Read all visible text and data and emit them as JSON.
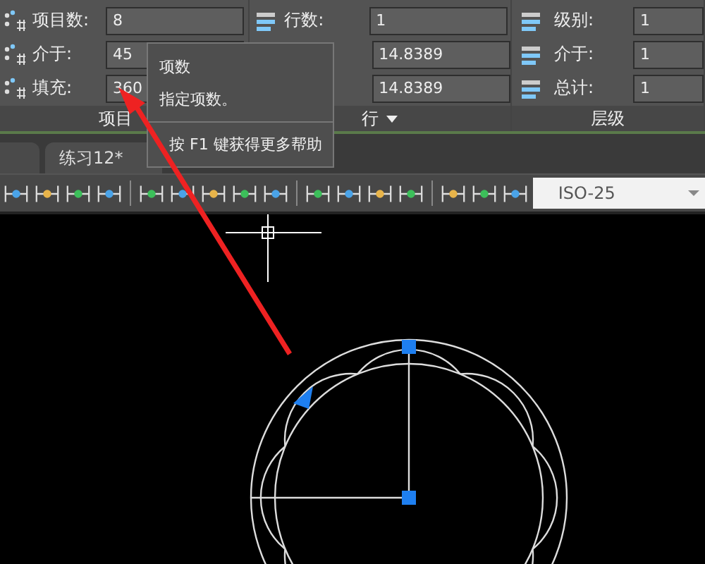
{
  "ribbon": {
    "panels": [
      {
        "label": "项目",
        "dropdown": false,
        "fields": [
          {
            "label": "项目数:",
            "value": "8"
          },
          {
            "label": "介于:",
            "value": "45"
          },
          {
            "label": "填充:",
            "value": "360"
          }
        ]
      },
      {
        "label": "行",
        "dropdown": true,
        "fields": [
          {
            "label": "行数:",
            "value": "1"
          },
          {
            "value": "14.8389"
          },
          {
            "value": "14.8389"
          }
        ]
      },
      {
        "label": "层级",
        "dropdown": false,
        "fields": [
          {
            "label": "级别:",
            "value": "1"
          },
          {
            "label": "介于:",
            "value": "1"
          },
          {
            "label": "总计:",
            "value": "1"
          }
        ]
      }
    ]
  },
  "tooltip": {
    "title": "项数",
    "description": "指定项数。",
    "help": "按 F1 键获得更多帮助"
  },
  "tabs": [
    {
      "label": "练习12*",
      "selected": true
    }
  ],
  "toolbar": {
    "dimension_style": "ISO-25"
  }
}
